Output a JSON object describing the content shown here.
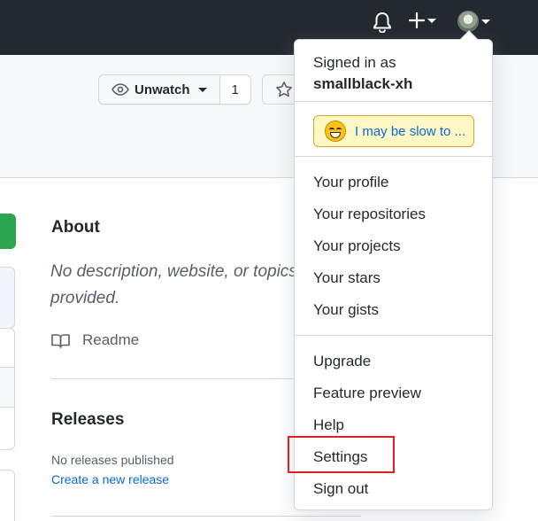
{
  "header": {
    "user_menu_caret": "▾",
    "icons": [
      "bell-icon",
      "plus-icon",
      "avatar"
    ],
    "colors": {
      "background": "#24292f",
      "icon": "#ffffff"
    }
  },
  "repo_actions": {
    "watch_label": "Unwatch",
    "watch_count": "1"
  },
  "sidebar": {
    "about_title": "About",
    "about_description": "No description, website, or topics provided.",
    "readme_label": "Readme",
    "releases_title": "Releases",
    "no_releases_text": "No releases published",
    "create_release_link": "Create a new release"
  },
  "user_menu": {
    "signed_in_as": "Signed in as",
    "username": "smallblack-xh",
    "status_text": "I may be slow to ...",
    "items_group1": [
      "Your profile",
      "Your repositories",
      "Your projects",
      "Your stars",
      "Your gists"
    ],
    "items_group2": [
      "Upgrade",
      "Feature preview",
      "Help",
      "Settings",
      "Sign out"
    ],
    "highlighted_item": "Settings",
    "colors": {
      "highlight_border": "#e31e24",
      "status_bg": "#fff8c5",
      "link": "#0969da"
    }
  }
}
